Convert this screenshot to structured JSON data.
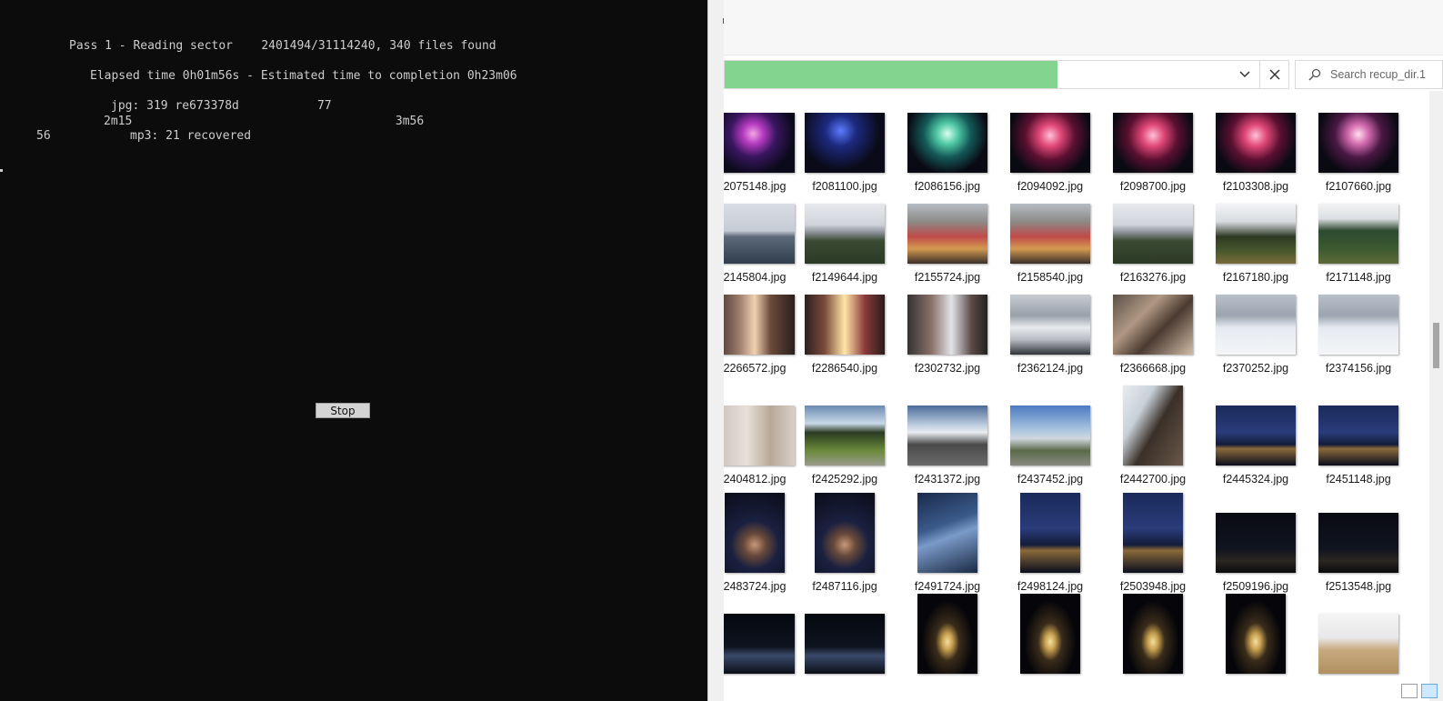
{
  "console": {
    "line1": "Pass 1 - Reading sector    2401494/31114240, 340 files found",
    "line2": "Elapsed time 0h01m56s - Estimated time to completion 0h23m06",
    "line3": "jpg: 319 re673378d           77",
    "line4": "2m15                                     3m56",
    "line5_num": "56",
    "line5_text": "mp3: 21 recovered",
    "stop_label": "Stop"
  },
  "explorer": {
    "address_progress_pct": 59,
    "search_placeholder": "Search recup_dir.1",
    "files": [
      {
        "name": "2075148.jpg",
        "theme": "t-fire"
      },
      {
        "name": "f2081100.jpg",
        "theme": "t-fire-b"
      },
      {
        "name": "f2086156.jpg",
        "theme": "t-fire-g"
      },
      {
        "name": "f2094092.jpg",
        "theme": "t-fire-r"
      },
      {
        "name": "f2098700.jpg",
        "theme": "t-fire-r"
      },
      {
        "name": "f2103308.jpg",
        "theme": "t-fire-r"
      },
      {
        "name": "f2107660.jpg",
        "theme": "t-fire-p"
      },
      {
        "name": "2145804.jpg",
        "theme": "t-lake"
      },
      {
        "name": "f2149644.jpg",
        "theme": "t-mount"
      },
      {
        "name": "f2155724.jpg",
        "theme": "t-stage"
      },
      {
        "name": "f2158540.jpg",
        "theme": "t-stage"
      },
      {
        "name": "f2163276.jpg",
        "theme": "t-mount"
      },
      {
        "name": "f2167180.jpg",
        "theme": "t-trees"
      },
      {
        "name": "f2171148.jpg",
        "theme": "t-trees2"
      },
      {
        "name": "2266572.jpg",
        "theme": "t-party"
      },
      {
        "name": "f2286540.jpg",
        "theme": "t-party2"
      },
      {
        "name": "f2302732.jpg",
        "theme": "t-party3"
      },
      {
        "name": "f2362124.jpg",
        "theme": "t-snowmt"
      },
      {
        "name": "f2366668.jpg",
        "theme": "t-selfie"
      },
      {
        "name": "f2370252.jpg",
        "theme": "t-snow"
      },
      {
        "name": "f2374156.jpg",
        "theme": "t-snow"
      },
      {
        "name": "2404812.jpg",
        "theme": "t-pass"
      },
      {
        "name": "f2425292.jpg",
        "theme": "t-park"
      },
      {
        "name": "f2431372.jpg",
        "theme": "t-road"
      },
      {
        "name": "f2437452.jpg",
        "theme": "t-town"
      },
      {
        "name": "f2442700.jpg",
        "theme": "t-man"
      },
      {
        "name": "f2445324.jpg",
        "theme": "t-night"
      },
      {
        "name": "f2451148.jpg",
        "theme": "t-night"
      },
      {
        "name": "2483724.jpg",
        "theme": "t-nselfie"
      },
      {
        "name": "f2487116.jpg",
        "theme": "t-nselfie"
      },
      {
        "name": "f2491724.jpg",
        "theme": "t-nbridge"
      },
      {
        "name": "f2498124.jpg",
        "theme": "t-night"
      },
      {
        "name": "f2503948.jpg",
        "theme": "t-night"
      },
      {
        "name": "f2509196.jpg",
        "theme": "t-ntower"
      },
      {
        "name": "f2513548.jpg",
        "theme": "t-ntower"
      },
      {
        "name": "",
        "theme": "t-nriver"
      },
      {
        "name": "",
        "theme": "t-nriver"
      },
      {
        "name": "",
        "theme": "t-eiffel"
      },
      {
        "name": "",
        "theme": "t-eiffel"
      },
      {
        "name": "",
        "theme": "t-eiffel"
      },
      {
        "name": "",
        "theme": "t-eiffel"
      },
      {
        "name": "",
        "theme": "t-field"
      }
    ]
  },
  "colors": {
    "console_bg": "#0c0c0c",
    "progress_green": "#82d48e"
  }
}
